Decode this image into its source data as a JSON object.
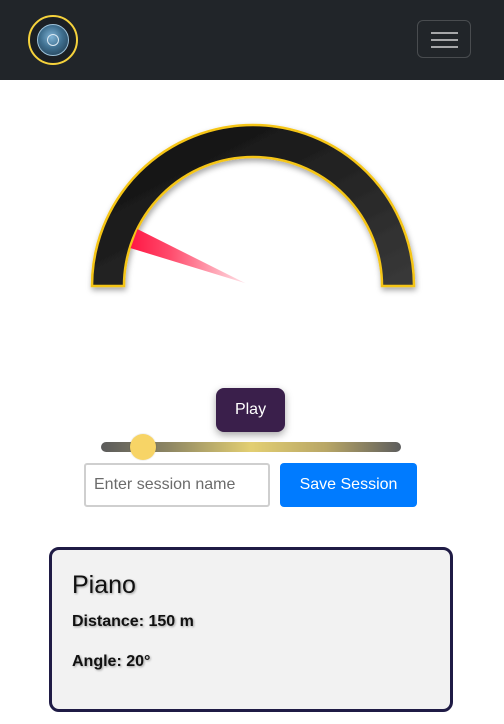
{
  "navbar": {
    "logo_icon": "compass-logo-icon",
    "menu_icon": "hamburger-menu-icon"
  },
  "gauge": {
    "angle_degrees": 20,
    "needle_color": "#ff1744",
    "arc_color": "#1a1a1a",
    "arc_outline_color": "#f5c518"
  },
  "controls": {
    "play_label": "Play",
    "play_color": "#3a1f4b",
    "slider_value": 0.14,
    "session_input_placeholder": "Enter session name",
    "session_input_value": "",
    "save_label": "Save Session",
    "save_color": "#007bff"
  },
  "info": {
    "title": "Piano",
    "distance": "Distance: 150 m",
    "angle": "Angle: 20°"
  }
}
